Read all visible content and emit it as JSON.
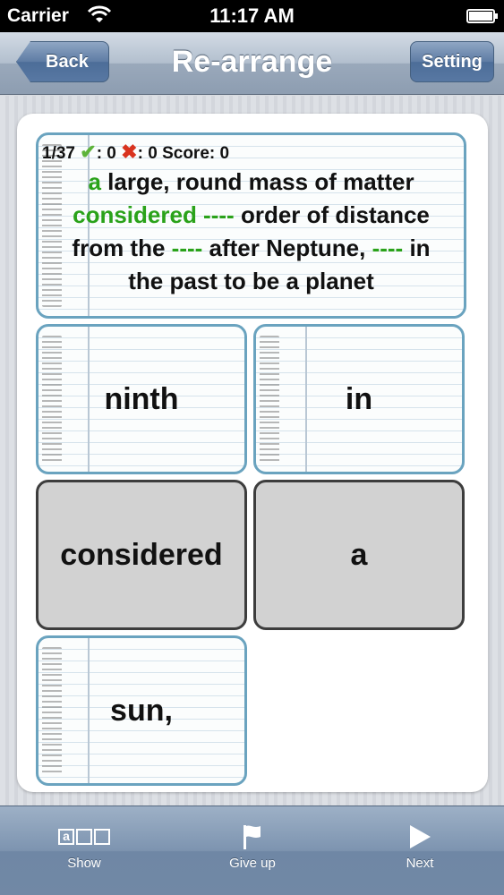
{
  "status": {
    "carrier": "Carrier",
    "time": "11:17 AM"
  },
  "nav": {
    "back": "Back",
    "title": "Re-arrange",
    "setting": "Setting"
  },
  "question": {
    "progress": "1/37",
    "correct_count": ": 0",
    "wrong_count": ": 0",
    "score": "Score: 0",
    "line1_a": "a",
    "line1_b": "large, round mass of matter",
    "line2_a": "considered ----",
    "line2_b": "order of distance",
    "line3_a": "from the",
    "line3_b": "----",
    "line3_c": "after Neptune,",
    "line3_d": "----",
    "line3_e": "in",
    "line4": "the past to be a planet"
  },
  "tiles": [
    "ninth",
    "in",
    "considered",
    "a",
    "sun,"
  ],
  "toolbar": {
    "show_label": "Show",
    "show_icon_letter": "a",
    "giveup_label": "Give up",
    "next_label": "Next"
  },
  "colors": {
    "answer_green": "#2aa21a",
    "tile_border_blue": "#6aa3bf",
    "tile_used_gray": "#d2d2d2"
  }
}
